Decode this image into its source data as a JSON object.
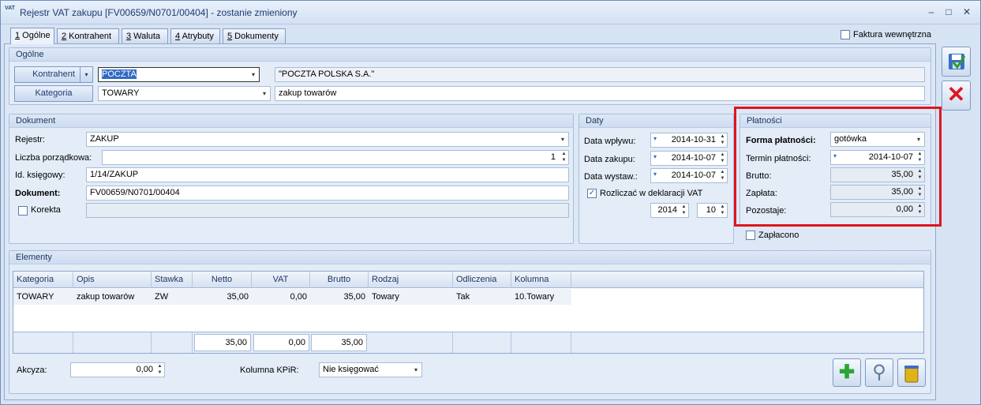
{
  "window": {
    "title": "Rejestr VAT zakupu [FV00659/N0701/00404] - zostanie zmieniony",
    "app_icon_text": "VAT",
    "minimize": "–",
    "maximize": "□",
    "close": "✕"
  },
  "tabs": [
    {
      "num": "1",
      "label": " Ogólne"
    },
    {
      "num": "2",
      "label": " Kontrahent"
    },
    {
      "num": "3",
      "label": " Waluta"
    },
    {
      "num": "4",
      "label": " Atrybuty"
    },
    {
      "num": "5",
      "label": " Dokumenty"
    }
  ],
  "faktura_wewnetrzna": "Faktura wewnętrzna",
  "ogolne": {
    "title": "Ogólne",
    "kontrahent_btn": "Kontrahent",
    "kontrahent_code": "POCZTA",
    "kontrahent_name": "\"POCZTA POLSKA S.A.\"",
    "kategoria_btn": "Kategoria",
    "kategoria_code": "TOWARY",
    "kategoria_desc": "zakup towarów"
  },
  "dokument": {
    "title": "Dokument",
    "rejestr_label": "Rejestr:",
    "rejestr_value": "ZAKUP",
    "lp_label": "Liczba porządkowa:",
    "lp_value": "1",
    "idk_label": "Id. księgowy:",
    "idk_value": "1/14/ZAKUP",
    "dok_label": "Dokument:",
    "dok_value": "FV00659/N0701/00404",
    "korekta_label": "Korekta"
  },
  "daty": {
    "title": "Daty",
    "wplywu_label": "Data wpływu:",
    "wplywu": "2014-10-31",
    "zakupu_label": "Data zakupu:",
    "zakupu": "2014-10-07",
    "wystaw_label": "Data wystaw.:",
    "wystaw": "2014-10-07",
    "rozliczac_label": "Rozliczać w deklaracji VAT",
    "rok": "2014",
    "miesiac": "10"
  },
  "platnosci": {
    "title": "Płatności",
    "forma_label": "Forma płatności:",
    "forma": "gotówka",
    "termin_label": "Termin płatności:",
    "termin": "2014-10-07",
    "brutto_label": "Brutto:",
    "brutto": "35,00",
    "zaplata_label": "Zapłata:",
    "zaplata": "35,00",
    "pozostaje_label": "Pozostaje:",
    "pozostaje": "0,00",
    "zaplacono_label": "Zapłacono"
  },
  "elementy": {
    "title": "Elementy",
    "columns": [
      "Kategoria",
      "Opis",
      "Stawka",
      "Netto",
      "VAT",
      "Brutto",
      "Rodzaj",
      "Odliczenia",
      "Kolumna"
    ],
    "row": [
      "TOWARY",
      "zakup towarów",
      "ZW",
      "35,00",
      "0,00",
      "35,00",
      "Towary",
      "Tak",
      "10.Towary"
    ],
    "totals": {
      "netto": "35,00",
      "vat": "0,00",
      "brutto": "35,00"
    },
    "akcyza_label": "Akcyza:",
    "akcyza": "0,00",
    "kpir_label": "Kolumna KPiR:",
    "kpir": "Nie księgować"
  },
  "colors": {
    "highlight_border": "#e0141e",
    "accent": "#2b4d86"
  }
}
